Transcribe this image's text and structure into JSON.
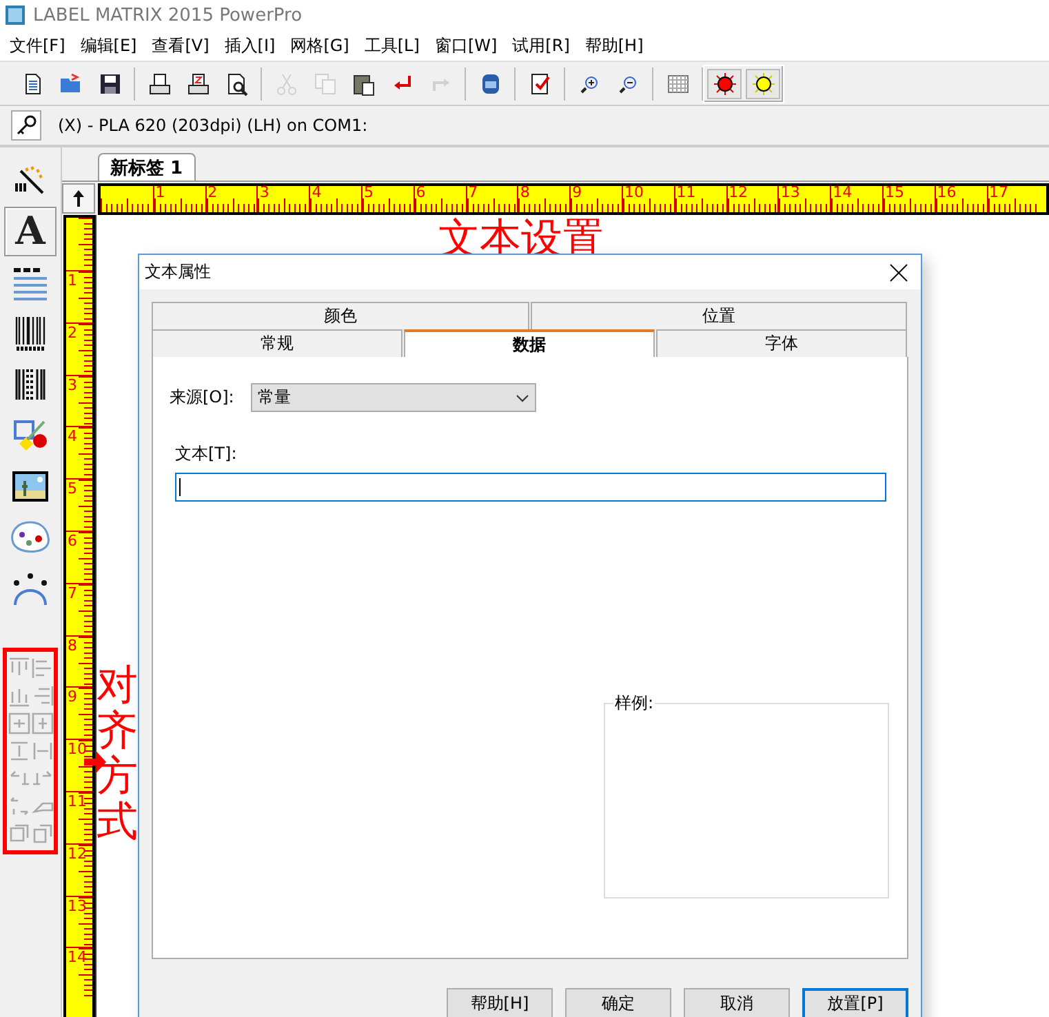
{
  "window": {
    "title": "LABEL MATRIX 2015 PowerPro"
  },
  "menu": [
    "文件[F]",
    "编辑[E]",
    "查看[V]",
    "插入[I]",
    "网格[G]",
    "工具[L]",
    "窗口[W]",
    "试用[R]",
    "帮助[H]"
  ],
  "toolbar": [
    [
      {
        "kind": "new",
        "disabled": false
      },
      {
        "kind": "open",
        "disabled": false
      },
      {
        "kind": "save",
        "disabled": false
      }
    ],
    [
      {
        "kind": "print",
        "disabled": false
      },
      {
        "kind": "print-setup",
        "disabled": false
      },
      {
        "kind": "print-preview",
        "disabled": false
      }
    ],
    [
      {
        "kind": "cut",
        "disabled": true
      },
      {
        "kind": "copy",
        "disabled": true
      },
      {
        "kind": "paste",
        "disabled": false
      },
      {
        "kind": "undo",
        "disabled": false
      },
      {
        "kind": "redo",
        "disabled": true
      }
    ],
    [
      {
        "kind": "database",
        "disabled": false
      }
    ],
    [
      {
        "kind": "check",
        "disabled": false
      }
    ],
    [
      {
        "kind": "zoom-in",
        "disabled": false
      },
      {
        "kind": "zoom-out",
        "disabled": false
      }
    ],
    [
      {
        "kind": "grid",
        "disabled": false
      }
    ],
    [
      {
        "kind": "red-light",
        "disabled": false
      },
      {
        "kind": "yellow-light",
        "disabled": false
      }
    ]
  ],
  "printer": {
    "label": "(X) - PLA 620 (203dpi) (LH) on COM1:"
  },
  "tools": [
    {
      "kind": "wand",
      "selected": false
    },
    {
      "kind": "text",
      "selected": true,
      "glyph": "A"
    },
    {
      "kind": "paragraph",
      "selected": false
    },
    {
      "kind": "barcode",
      "selected": false
    },
    {
      "kind": "barcode-2d",
      "selected": false
    },
    {
      "kind": "shapes",
      "selected": false
    },
    {
      "kind": "picture",
      "selected": false
    },
    {
      "kind": "palette",
      "selected": false
    },
    {
      "kind": "arc-text",
      "selected": false
    }
  ],
  "align_tools": [
    {
      "kind": "align-top",
      "disabled": true
    },
    {
      "kind": "align-left",
      "disabled": true
    },
    {
      "kind": "align-bottom",
      "disabled": true
    },
    {
      "kind": "align-right",
      "disabled": true
    },
    {
      "kind": "center-vertical",
      "disabled": true
    },
    {
      "kind": "center-horizontal",
      "disabled": true
    },
    {
      "kind": "space-vertical",
      "disabled": true
    },
    {
      "kind": "space-horizontal",
      "disabled": true
    },
    {
      "kind": "rotate-left",
      "disabled": true
    },
    {
      "kind": "rotate-right",
      "disabled": true
    },
    {
      "kind": "rotate-both",
      "disabled": true
    },
    {
      "kind": "hand",
      "disabled": true
    },
    {
      "kind": "group",
      "disabled": true
    },
    {
      "kind": "ungroup",
      "disabled": true
    }
  ],
  "document_tab": {
    "label": "新标签 1",
    "selected": true
  },
  "ruler": {
    "horizontal": [
      "1",
      "2",
      "3",
      "4",
      "5",
      "6",
      "7",
      "8",
      "9",
      "10",
      "11",
      "12",
      "13",
      "14",
      "15",
      "16",
      "17"
    ],
    "vertical": [
      "1",
      "2",
      "3",
      "4",
      "5",
      "6",
      "7",
      "8",
      "9",
      "10",
      "11",
      "12",
      "13",
      "14"
    ]
  },
  "annotations": [
    {
      "kind": "title",
      "text": "文本设置"
    },
    {
      "kind": "side",
      "text": "对齐方式"
    }
  ],
  "dialog": {
    "title": "文本属性",
    "tab_rows": [
      [
        {
          "label": "颜色",
          "selected": false
        },
        {
          "label": "位置",
          "selected": false
        }
      ],
      [
        {
          "label": "常规",
          "selected": false
        },
        {
          "label": "数据",
          "selected": true
        },
        {
          "label": "字体",
          "selected": false
        }
      ]
    ],
    "source_label": "来源[O]:",
    "source_value": "常量",
    "text_label": "文本[T]:",
    "text_focused": true,
    "sample_label": "样例:",
    "buttons": [
      {
        "label": "帮助[H]",
        "focused": false
      },
      {
        "label": "确定",
        "focused": false
      },
      {
        "label": "取消",
        "focused": false
      },
      {
        "label": "放置[P]",
        "focused": true
      }
    ]
  }
}
